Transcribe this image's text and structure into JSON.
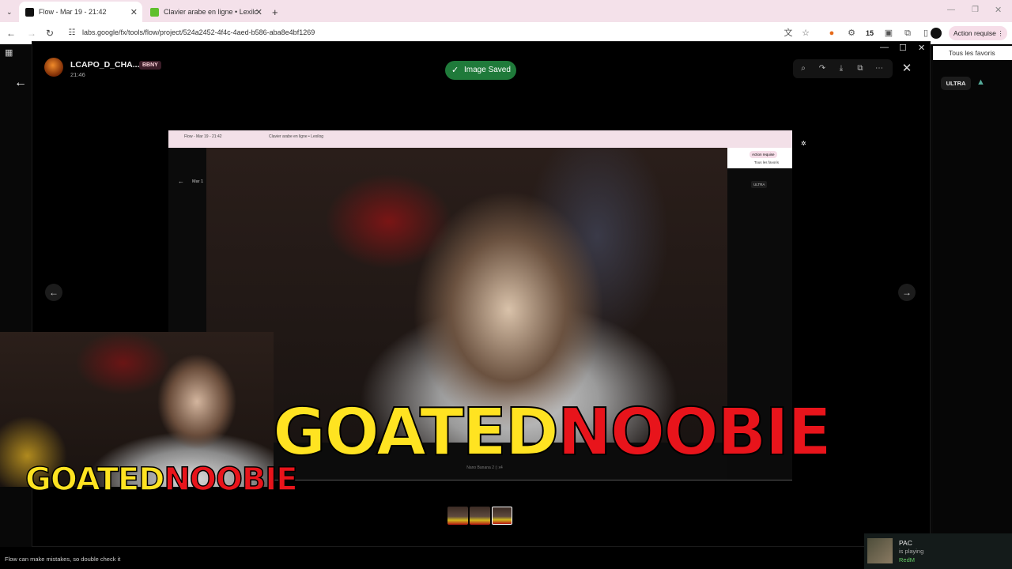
{
  "browser": {
    "tabs": [
      {
        "title": "Flow - Mar 19 - 21:42",
        "active": true
      },
      {
        "title": "Clavier arabe en ligne • Lexilog",
        "active": false
      }
    ],
    "url": "labs.google/fx/tools/flow/project/524a2452-4f4c-4aed-b586-aba8e4bf1269",
    "badge_count": "15",
    "action_button": "Action requise",
    "bookmarks_label": "Tous les favoris"
  },
  "viewer": {
    "username": "LCAPO_D_CHA...",
    "badge": "BBNY",
    "time": "21:46",
    "toast": "Image Saved",
    "plan_badge": "ULTRA"
  },
  "image": {
    "inner_tab1": "Flow - Mar 19 - 21:42",
    "inner_tab2": "Clavier arabe en ligne • Lexilog",
    "inner_action": "Action requise",
    "inner_favs": "Tous les favoris",
    "inner_title": "Mar 1",
    "inner_ultra": "ULTRA",
    "inner_controls": "Nano Banana 2  ▯ x4",
    "logo_yellow": "GOATED",
    "logo_red": "NOOBIE"
  },
  "cam": {
    "logo_yellow": "GOATED",
    "logo_red": "NOOBIE"
  },
  "footer": {
    "disclaimer": "Flow can make mistakes, so double check it"
  },
  "notification": {
    "name": "PAC",
    "status": "is playing",
    "game": "RedM"
  },
  "colors": {
    "toast_bg": "#1f7a3a",
    "logo_yellow": "#ffe321",
    "logo_red": "#e8141b"
  }
}
